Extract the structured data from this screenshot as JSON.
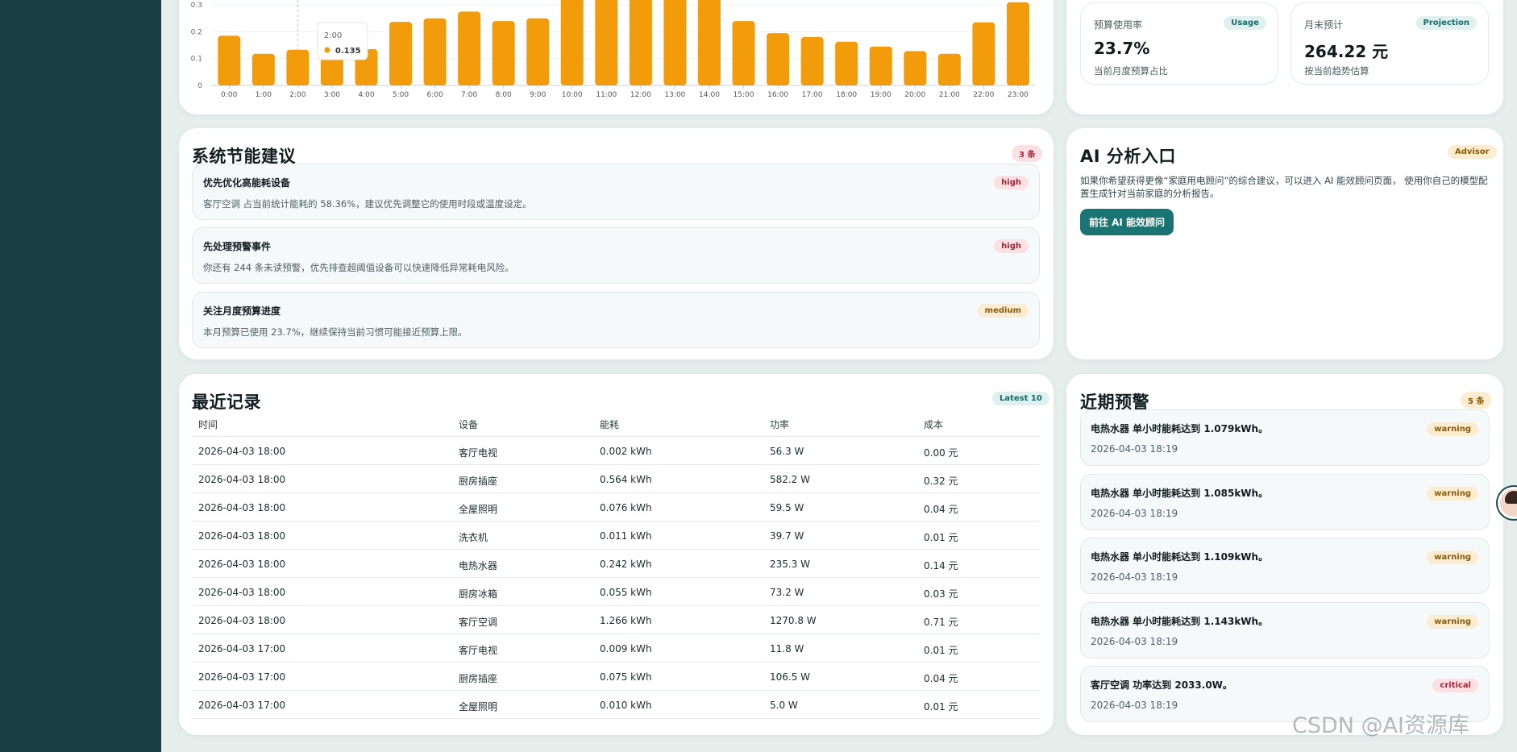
{
  "chart_data": {
    "type": "bar",
    "categories": [
      "0:00",
      "1:00",
      "2:00",
      "3:00",
      "4:00",
      "5:00",
      "6:00",
      "7:00",
      "8:00",
      "9:00",
      "10:00",
      "11:00",
      "12:00",
      "13:00",
      "14:00",
      "15:00",
      "16:00",
      "17:00",
      "18:00",
      "19:00",
      "20:00",
      "21:00",
      "22:00",
      "23:00"
    ],
    "values": [
      0.185,
      0.118,
      0.133,
      0.148,
      0.135,
      0.237,
      0.25,
      0.275,
      0.24,
      0.25,
      0.42,
      0.45,
      0.44,
      0.43,
      0.41,
      0.24,
      0.195,
      0.18,
      0.163,
      0.145,
      0.128,
      0.118,
      0.235,
      0.31
    ],
    "y_ticks": [
      "0",
      "0.1",
      "0.2",
      "0.3"
    ],
    "ylim": [
      0,
      0.3
    ],
    "bar_color": "#f39c0b",
    "tooltip": {
      "label": "2:00",
      "value": "0.135"
    }
  },
  "stats": [
    {
      "label": "预算使用率",
      "badge": "Usage",
      "value": "23.7%",
      "note": "当前月度预算占比"
    },
    {
      "label": "月末预计",
      "badge": "Projection",
      "value": "264.22 元",
      "note": "按当前趋势估算"
    }
  ],
  "suggestions": {
    "title": "系统节能建议",
    "count": "3 条",
    "items": [
      {
        "title": "优先优化高能耗设备",
        "body": "客厅空调 占当前统计能耗的 58.36%，建议优先调整它的使用时段或温度设定。",
        "level": "high"
      },
      {
        "title": "先处理预警事件",
        "body": "你还有 244 条未读预警，优先排查超阈值设备可以快速降低异常耗电风险。",
        "level": "high"
      },
      {
        "title": "关注月度预算进度",
        "body": "本月预算已使用 23.7%，继续保持当前习惯可能接近预算上限。",
        "level": "medium"
      }
    ]
  },
  "ai": {
    "title": "AI 分析入口",
    "badge": "Advisor",
    "desc": "如果你希望获得更像“家庭用电顾问”的综合建议，可以进入 AI 能效顾问页面， 使用你自己的模型配置生成针对当前家庭的分析报告。",
    "button": "前往 AI 能效顾问"
  },
  "records": {
    "title": "最近记录",
    "badge": "Latest 10",
    "columns": [
      "时间",
      "设备",
      "能耗",
      "功率",
      "成本"
    ],
    "rows": [
      [
        "2026-04-03 18:00",
        "客厅电视",
        "0.002 kWh",
        "56.3 W",
        "0.00 元"
      ],
      [
        "2026-04-03 18:00",
        "厨房插座",
        "0.564 kWh",
        "582.2 W",
        "0.32 元"
      ],
      [
        "2026-04-03 18:00",
        "全屋照明",
        "0.076 kWh",
        "59.5 W",
        "0.04 元"
      ],
      [
        "2026-04-03 18:00",
        "洗衣机",
        "0.011 kWh",
        "39.7 W",
        "0.01 元"
      ],
      [
        "2026-04-03 18:00",
        "电热水器",
        "0.242 kWh",
        "235.3 W",
        "0.14 元"
      ],
      [
        "2026-04-03 18:00",
        "厨房冰箱",
        "0.055 kWh",
        "73.2 W",
        "0.03 元"
      ],
      [
        "2026-04-03 18:00",
        "客厅空调",
        "1.266 kWh",
        "1270.8 W",
        "0.71 元"
      ],
      [
        "2026-04-03 17:00",
        "客厅电视",
        "0.009 kWh",
        "11.8 W",
        "0.01 元"
      ],
      [
        "2026-04-03 17:00",
        "厨房插座",
        "0.075 kWh",
        "106.5 W",
        "0.04 元"
      ],
      [
        "2026-04-03 17:00",
        "全屋照明",
        "0.010 kWh",
        "5.0 W",
        "0.01 元"
      ]
    ]
  },
  "alerts": {
    "title": "近期预警",
    "count": "5 条",
    "items": [
      {
        "title": "电热水器 单小时能耗达到 1.079kWh。",
        "time": "2026-04-03 18:19",
        "level": "warning"
      },
      {
        "title": "电热水器 单小时能耗达到 1.085kWh。",
        "time": "2026-04-03 18:19",
        "level": "warning"
      },
      {
        "title": "电热水器 单小时能耗达到 1.109kWh。",
        "time": "2026-04-03 18:19",
        "level": "warning"
      },
      {
        "title": "电热水器 单小时能耗达到 1.143kWh。",
        "time": "2026-04-03 18:19",
        "level": "warning"
      },
      {
        "title": "客厅空调 功率达到 2033.0W。",
        "time": "2026-04-03 18:19",
        "level": "critical"
      }
    ]
  },
  "watermark": "CSDN @AI资源库"
}
